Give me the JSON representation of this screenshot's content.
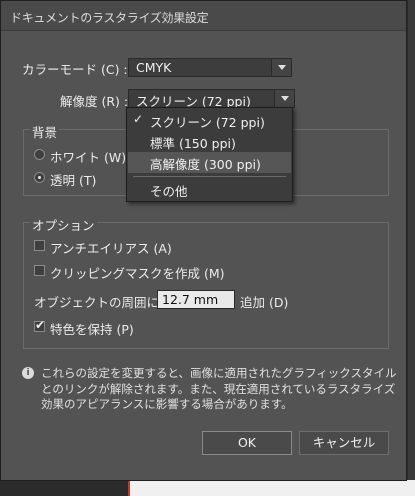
{
  "dialog": {
    "title": "ドキュメントのラスタライズ効果設定"
  },
  "color_mode": {
    "label": "カラーモード (C) :",
    "value": "CMYK"
  },
  "resolution": {
    "label": "解像度 (R) :",
    "value": "スクリーン (72 ppi)",
    "menu": [
      {
        "label": "スクリーン (72 ppi)",
        "checked": true
      },
      {
        "label": "標準 (150 ppi)",
        "checked": false
      },
      {
        "label": "高解像度 (300 ppi)",
        "checked": false,
        "highlighted": true
      },
      {
        "label": "その他",
        "checked": false
      }
    ]
  },
  "background": {
    "title": "背景",
    "white_label": "ホワイト (W)",
    "transparent_label": "透明 (T)",
    "selected": "transparent"
  },
  "options": {
    "title": "オプション",
    "antialias_label": "アンチエイリアス (A)",
    "antialias_checked": false,
    "clipping_label": "クリッピングマスクを作成 (M)",
    "clipping_checked": false,
    "padding_label": "オブジェクトの周囲に",
    "padding_value": "12.7 mm",
    "padding_suffix": "追加 (D)",
    "spot_label": "特色を保持 (P)",
    "spot_checked": true
  },
  "info": {
    "icon": "info-icon",
    "line1": "これらの設定を変更すると、画像に適用されたグラフィックスタイル",
    "line2": "とのリンクが解除されます。また、現在適用されているラスタライズ",
    "line3": "効果のアピアランスに影響する場合があります。"
  },
  "buttons": {
    "ok": "OK",
    "cancel": "キャンセル"
  }
}
